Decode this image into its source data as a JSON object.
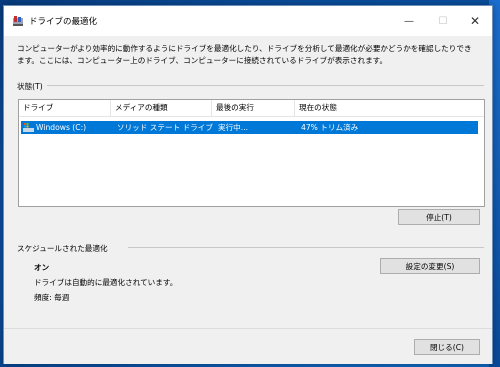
{
  "window": {
    "title": "ドライブの最適化",
    "minimize_glyph": "—",
    "maximize_glyph": "☐",
    "close_glyph": "✕"
  },
  "description": "コンピューターがより効率的に動作するようにドライブを最適化したり、ドライブを分析して最適化が必要かどうかを確認したりできます。ここには、コンピューター上のドライブ、コンピューターに接続されているドライブが表示されます。",
  "status": {
    "label": "状態(T)",
    "columns": [
      "ドライブ",
      "メディアの種類",
      "最後の実行",
      "現在の状態"
    ],
    "rows": [
      {
        "drive": "Windows (C:)",
        "media_type": "ソリッド ステート ドライブ",
        "last_run": "実行中...",
        "current_status": "47% トリム済み",
        "trim_progress_percent": 47
      }
    ],
    "stop_button": "停止(T)"
  },
  "schedule": {
    "label": "スケジュールされた最適化",
    "state": "オン",
    "detail": "ドライブは自動的に最適化されています。",
    "frequency": "頻度: 毎週",
    "change_button": "設定の変更(S)"
  },
  "footer": {
    "close_button": "閉じる(C)"
  },
  "colors": {
    "selection": "#0078d7",
    "window_bg": "#f0f0f0"
  }
}
